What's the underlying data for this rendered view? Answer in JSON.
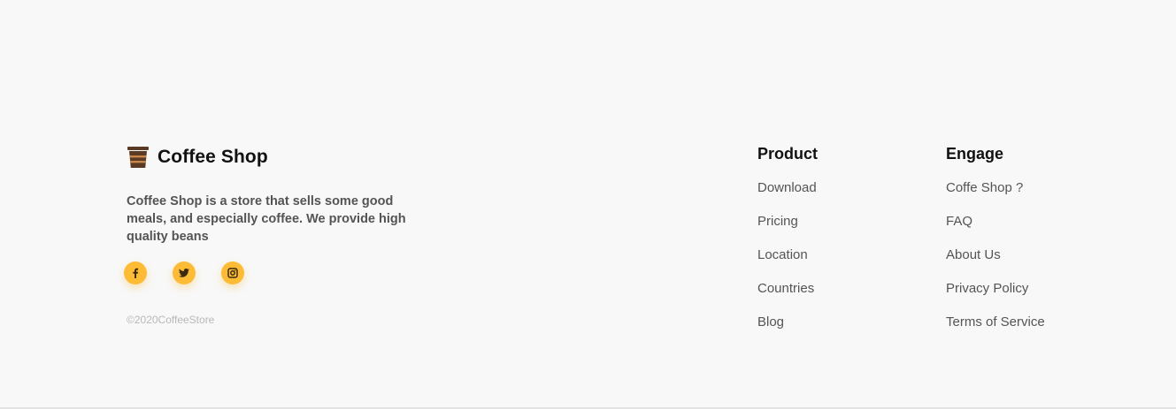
{
  "brand": {
    "name": "Coffee Shop",
    "logo_icon": "coffee-cup-icon",
    "logo_colors": {
      "lid": "#5a3a22",
      "band": "#c9874c"
    }
  },
  "description": "Coffee Shop is a store that sells some good meals, and especially coffee. We provide high quality beans",
  "socials": [
    {
      "icon": "facebook-icon"
    },
    {
      "icon": "twitter-icon"
    },
    {
      "icon": "instagram-icon"
    }
  ],
  "social_color": "#fdbb36",
  "copyright": "©2020CoffeeStore",
  "columns": {
    "product": {
      "title": "Product",
      "links": [
        "Download",
        "Pricing",
        "Location",
        "Countries",
        "Blog"
      ]
    },
    "engage": {
      "title": "Engage",
      "links": [
        "Coffe Shop ?",
        "FAQ",
        "About Us",
        "Privacy Policy",
        "Terms of Service"
      ]
    }
  }
}
